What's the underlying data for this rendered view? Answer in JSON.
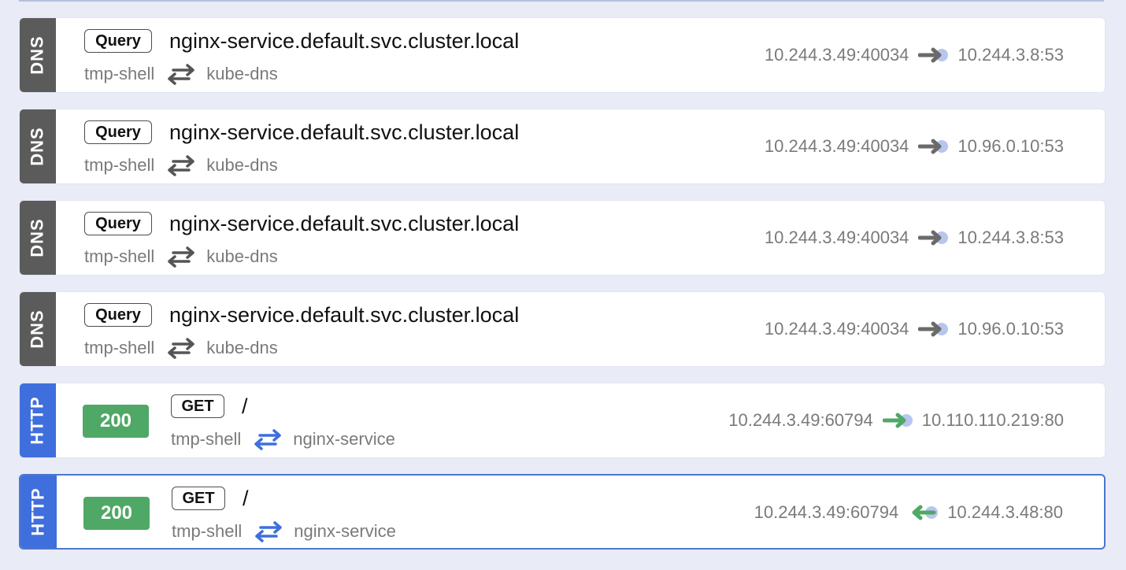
{
  "colors": {
    "dns_tag": "#5b5b5b",
    "http_tag": "#3f6fdc",
    "status_ok": "#4fa866",
    "selected_border": "#4b77d0",
    "arrow_gray": "#6a6a6a",
    "arrow_green": "#4fa866",
    "arrow_blue": "#3f6fdc",
    "arrow_tail": "#b8c6ee"
  },
  "entries": [
    {
      "protocol": "DNS",
      "badge": "Query",
      "summary": "nginx-service.default.svc.cluster.local",
      "source_name": "tmp-shell",
      "dest_name": "kube-dns",
      "src_addr": "10.244.3.49:40034",
      "dst_addr": "10.244.3.8:53",
      "direction_icon": "outgoing-arrow-icon"
    },
    {
      "protocol": "DNS",
      "badge": "Query",
      "summary": "nginx-service.default.svc.cluster.local",
      "source_name": "tmp-shell",
      "dest_name": "kube-dns",
      "src_addr": "10.244.3.49:40034",
      "dst_addr": "10.96.0.10:53",
      "direction_icon": "outgoing-arrow-icon"
    },
    {
      "protocol": "DNS",
      "badge": "Query",
      "summary": "nginx-service.default.svc.cluster.local",
      "source_name": "tmp-shell",
      "dest_name": "kube-dns",
      "src_addr": "10.244.3.49:40034",
      "dst_addr": "10.244.3.8:53",
      "direction_icon": "outgoing-arrow-icon"
    },
    {
      "protocol": "DNS",
      "badge": "Query",
      "summary": "nginx-service.default.svc.cluster.local",
      "source_name": "tmp-shell",
      "dest_name": "kube-dns",
      "src_addr": "10.244.3.49:40034",
      "dst_addr": "10.96.0.10:53",
      "direction_icon": "outgoing-arrow-icon"
    },
    {
      "protocol": "HTTP",
      "status": "200",
      "badge": "GET",
      "summary": "/",
      "source_name": "tmp-shell",
      "dest_name": "nginx-service",
      "src_addr": "10.244.3.49:60794",
      "dst_addr": "10.110.110.219:80",
      "direction_icon": "outgoing-arrow-icon"
    },
    {
      "protocol": "HTTP",
      "status": "200",
      "badge": "GET",
      "summary": "/",
      "source_name": "tmp-shell",
      "dest_name": "nginx-service",
      "src_addr": "10.244.3.49:60794",
      "dst_addr": "10.244.3.48:80",
      "direction_icon": "incoming-arrow-icon",
      "selected": true
    }
  ]
}
